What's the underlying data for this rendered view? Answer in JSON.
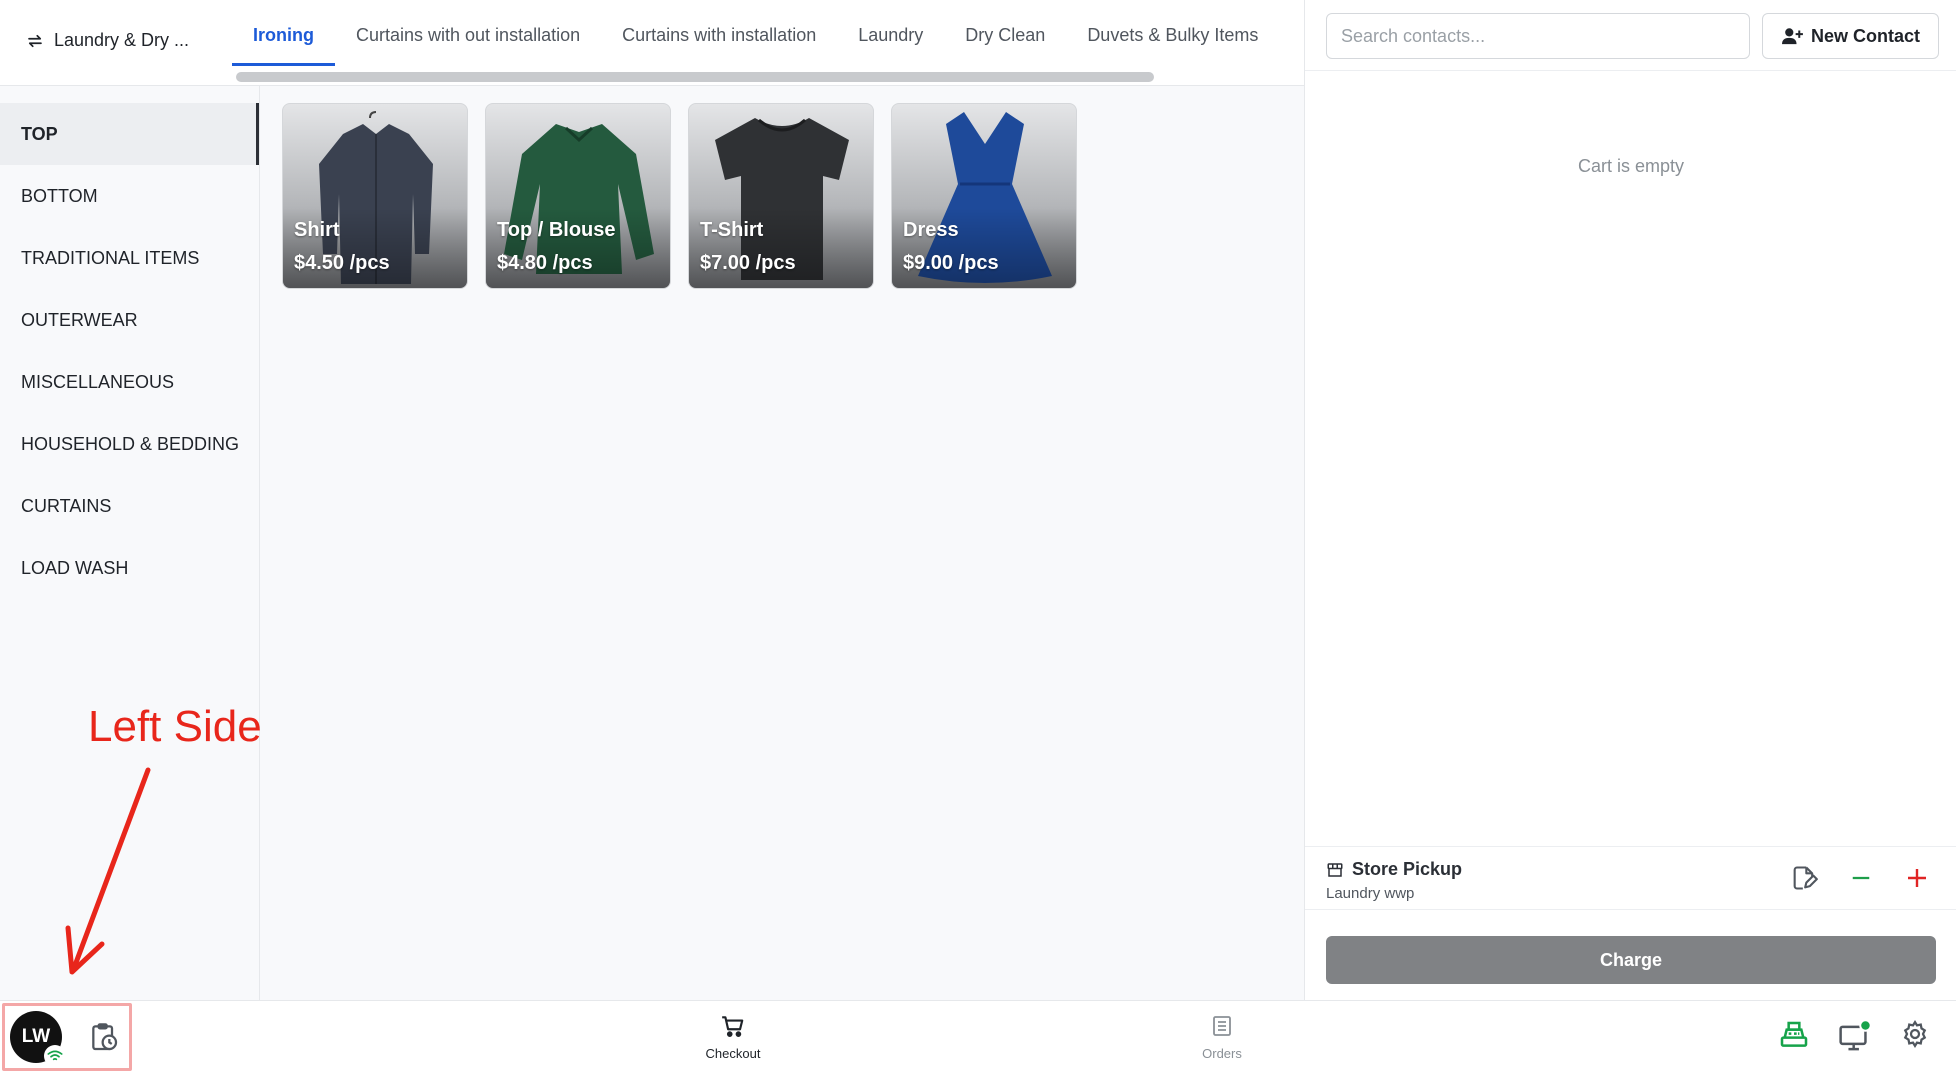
{
  "store": {
    "name": "Laundry & Dry ..."
  },
  "tabs": [
    {
      "label": "Ironing",
      "active": true
    },
    {
      "label": "Curtains with out installation"
    },
    {
      "label": "Curtains with installation"
    },
    {
      "label": "Laundry"
    },
    {
      "label": "Dry Clean"
    },
    {
      "label": "Duvets & Bulky Items"
    }
  ],
  "categories": [
    {
      "label": "TOP",
      "active": true
    },
    {
      "label": "BOTTOM"
    },
    {
      "label": "TRADITIONAL ITEMS"
    },
    {
      "label": "OUTERWEAR"
    },
    {
      "label": "MISCELLANEOUS"
    },
    {
      "label": "HOUSEHOLD & BEDDING"
    },
    {
      "label": "CURTAINS"
    },
    {
      "label": "LOAD WASH"
    }
  ],
  "products": [
    {
      "name": "Shirt",
      "price": "$4.50 /pcs",
      "color": "#3a4150"
    },
    {
      "name": "Top / Blouse",
      "price": "$4.80 /pcs",
      "color": "#245a3e"
    },
    {
      "name": "T-Shirt",
      "price": "$7.00 /pcs",
      "color": "#2f3134"
    },
    {
      "name": "Dress",
      "price": "$9.00 /pcs",
      "color": "#1e4a9a"
    }
  ],
  "cart": {
    "search_placeholder": "Search contacts...",
    "new_contact_label": "New Contact",
    "empty_text": "Cart is empty",
    "pickup_title": "Store Pickup",
    "pickup_subtitle": "Laundry wwp",
    "charge_label": "Charge"
  },
  "bottom": {
    "avatar_initials": "LW",
    "checkout_label": "Checkout",
    "orders_label": "Orders"
  },
  "annotation": {
    "text": "Left Side"
  },
  "colors": {
    "accent": "#1d5bd8",
    "minus": "#1e9e4a",
    "plus": "#e02424",
    "annotation": "#e8261b",
    "register": "#16a34a"
  },
  "icons": {
    "store_switch": "swap-arrows-icon",
    "new_contact": "person-plus-icon",
    "pickup": "storefront-icon",
    "checkout": "cart-icon",
    "orders": "list-icon"
  }
}
